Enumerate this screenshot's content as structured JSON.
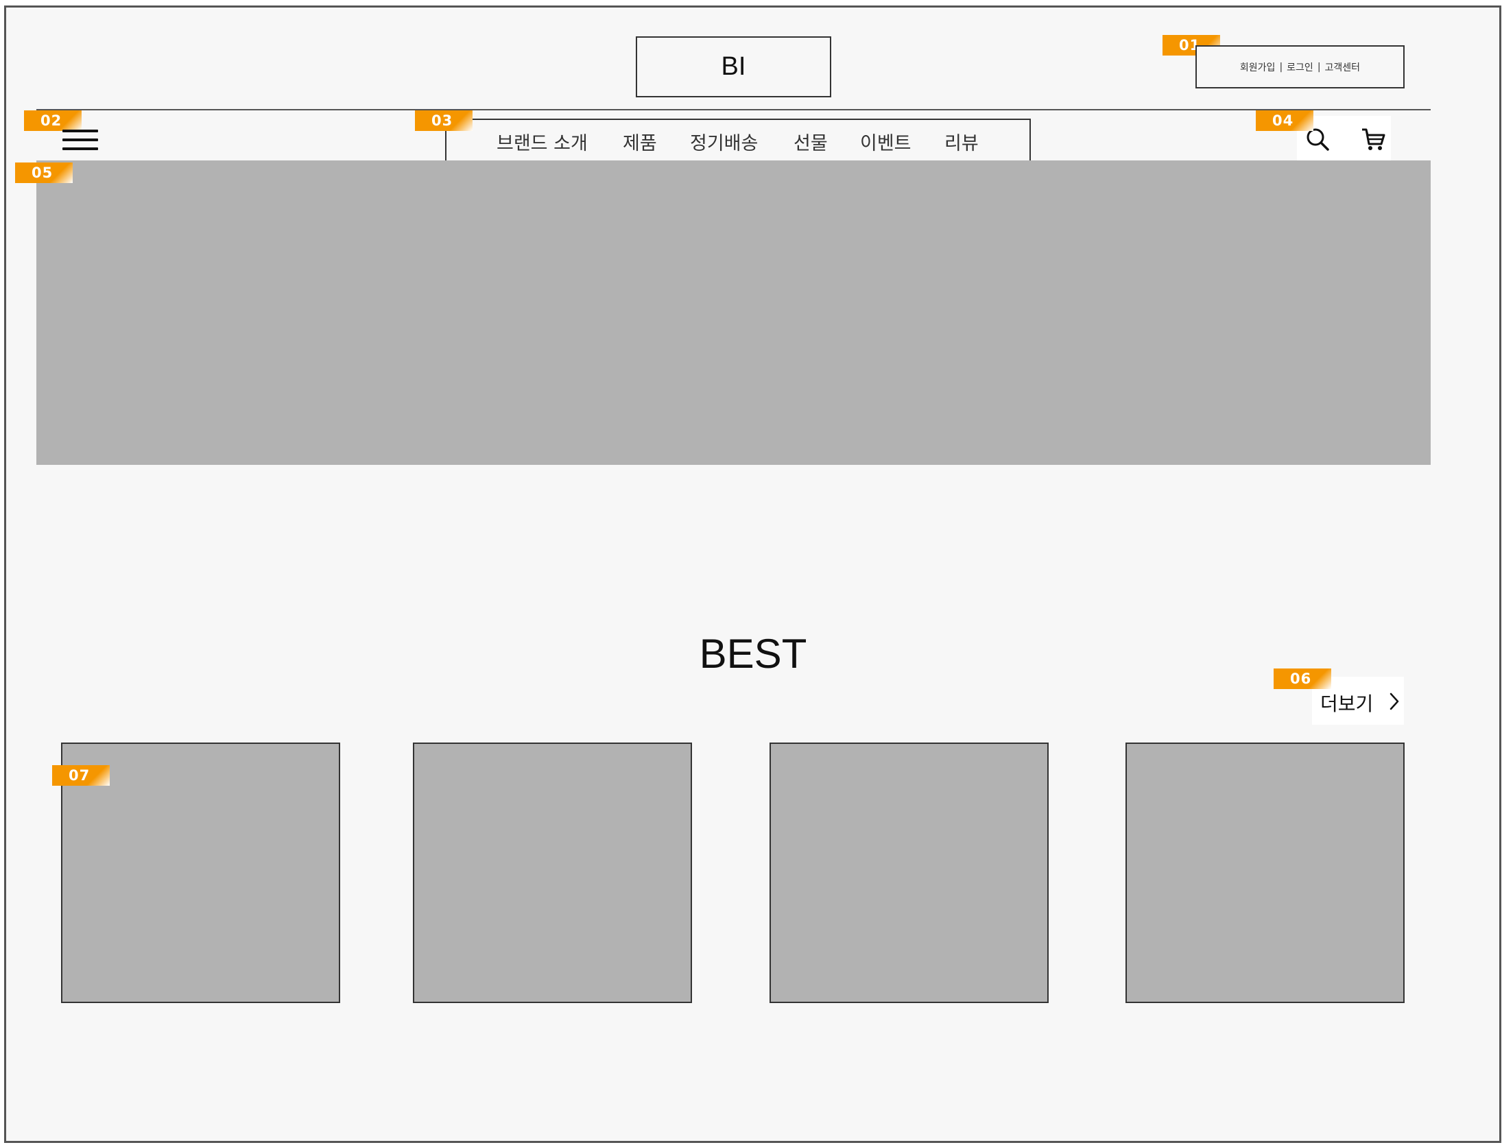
{
  "header": {
    "logo_text": "BI",
    "utility_links": {
      "signup": "회원가입",
      "login": "로그인",
      "support": "고객센터",
      "separator": "|"
    }
  },
  "nav": {
    "items": [
      "브랜드 소개",
      "제품",
      "정기배송",
      "선물",
      "이벤트",
      "리뷰"
    ]
  },
  "icons": {
    "menu": "hamburger-menu-icon",
    "search": "search-icon",
    "cart": "cart-icon",
    "more": "chevron-right-icon"
  },
  "best": {
    "title": "BEST",
    "more_label": "더보기"
  },
  "annotations": {
    "utility": "01",
    "menu": "02",
    "nav": "03",
    "icons": "04",
    "banner": "05",
    "more": "06",
    "product": "07"
  },
  "colors": {
    "badge": "#f59600",
    "placeholder": "#b2b2b2",
    "background": "#f7f7f7",
    "border": "#333333"
  }
}
